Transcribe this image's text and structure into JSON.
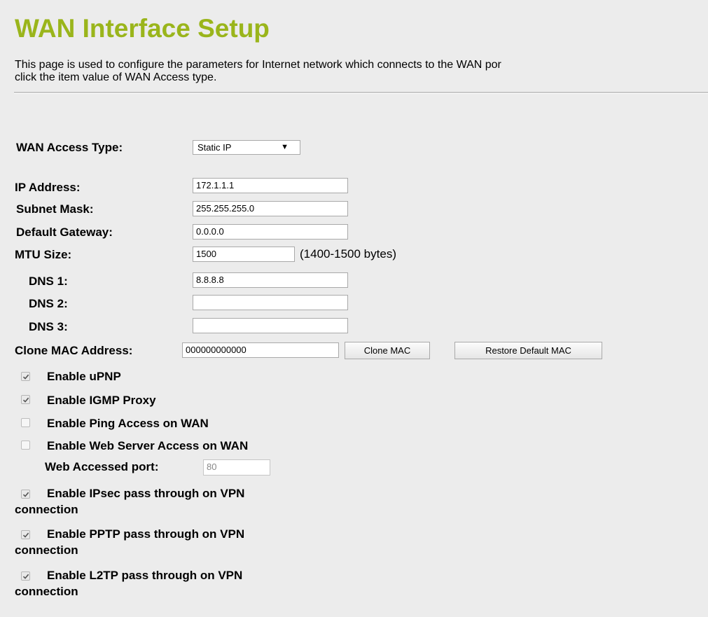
{
  "page": {
    "title": "WAN Interface Setup",
    "description_line1": "This page is used to configure the parameters for Internet network which connects to the WAN por",
    "description_line2": "click the item value of WAN Access type."
  },
  "form": {
    "wan_access_type_label": "WAN Access Type:",
    "wan_access_type_value": "Static IP",
    "ip_address_label": "IP Address:",
    "ip_address_value": "172.1.1.1",
    "subnet_mask_label": "Subnet Mask:",
    "subnet_mask_value": "255.255.255.0",
    "default_gateway_label": "Default Gateway:",
    "default_gateway_value": "0.0.0.0",
    "mtu_label": "MTU Size:",
    "mtu_value": "1500",
    "mtu_hint": "(1400-1500 bytes)",
    "dns1_label": "DNS 1:",
    "dns1_value": "8.8.8.8",
    "dns2_label": "DNS 2:",
    "dns2_value": "",
    "dns3_label": "DNS 3:",
    "dns3_value": "",
    "clone_mac_label": "Clone MAC Address:",
    "clone_mac_value": "000000000000",
    "clone_mac_button": "Clone MAC",
    "restore_mac_button": "Restore Default MAC",
    "web_port_label": "Web Accessed port:",
    "web_port_value": "80"
  },
  "options": [
    {
      "label": "Enable uPNP",
      "checked": true
    },
    {
      "label": "Enable IGMP Proxy",
      "checked": true
    },
    {
      "label": "Enable Ping Access on WAN",
      "checked": false
    },
    {
      "label": "Enable Web Server Access on WAN",
      "checked": false
    },
    {
      "label": "Enable IPsec pass through on VPN",
      "label_cont": "connection",
      "checked": true
    },
    {
      "label": "Enable PPTP pass through on VPN",
      "label_cont": "connection",
      "checked": true
    },
    {
      "label": "Enable L2TP pass through on VPN",
      "label_cont": "connection",
      "checked": true
    }
  ]
}
